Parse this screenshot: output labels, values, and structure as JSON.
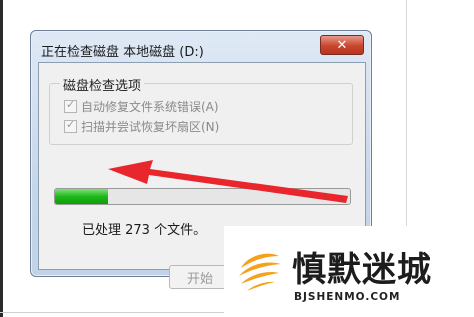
{
  "dialog": {
    "title": "正在检查磁盘 本地磁盘 (D:)",
    "close_label": "✕"
  },
  "options_group": {
    "legend": "磁盘检查选项",
    "items": [
      {
        "label": "自动修复文件系统错误(A)",
        "checked": true,
        "enabled": false
      },
      {
        "label": "扫描并尝试恢复坏扇区(N)",
        "checked": true,
        "enabled": false
      }
    ]
  },
  "progress": {
    "fraction": 0.18
  },
  "status": {
    "text": "已处理 273 个文件。"
  },
  "buttons": {
    "start_label": "开始"
  },
  "watermark": {
    "name": "慎默迷城",
    "domain": "BJSHENMO.COM"
  },
  "colors": {
    "progress_green": "#1fb81a",
    "annotation_arrow": "#e8262b",
    "close_red": "#c9462e",
    "logo_orange": "#f5a11c"
  }
}
